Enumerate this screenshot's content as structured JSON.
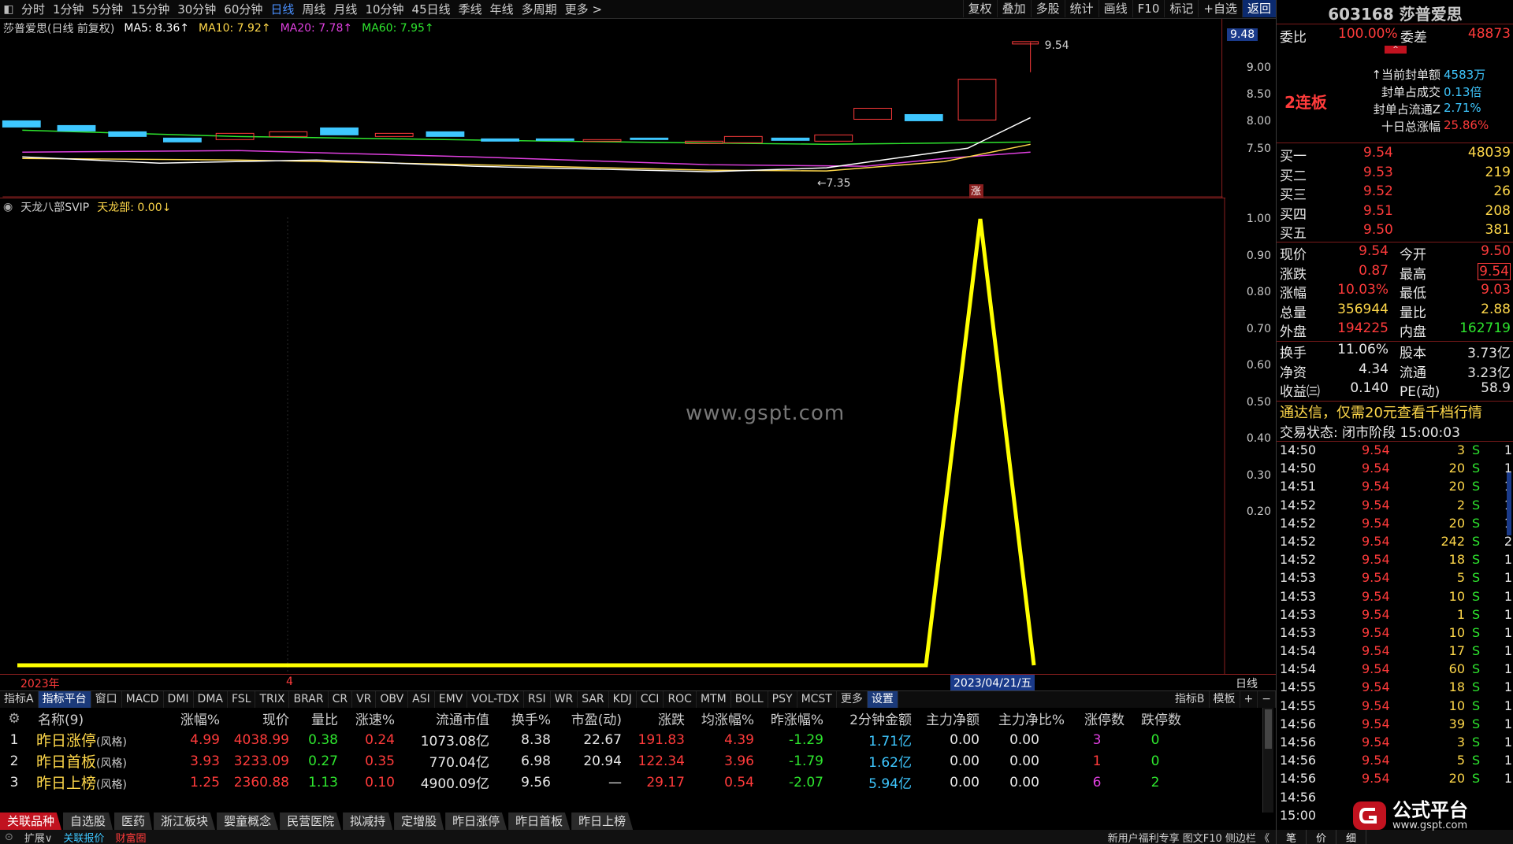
{
  "toolbar": {
    "periods": [
      "分时",
      "1分钟",
      "5分钟",
      "15分钟",
      "30分钟",
      "60分钟",
      "日线",
      "周线",
      "月线",
      "10分钟",
      "45日线",
      "季线",
      "年线",
      "多周期",
      "更多 >"
    ],
    "active_period": "日线",
    "right_buttons": [
      "复权",
      "叠加",
      "多股",
      "统计",
      "画线",
      "F10",
      "标记",
      "+自选",
      "返回"
    ]
  },
  "legend": {
    "title": "莎普爱思(日线 前复权)",
    "ma5": "MA5: 8.36↑",
    "ma10": "MA10: 7.92↑",
    "ma20": "MA20: 7.78↑",
    "ma60": "MA60: 7.95↑",
    "ma5_color": "#ffffff",
    "ma10_color": "#ffd84a",
    "ma20_color": "#e040e0",
    "ma60_color": "#2ee52e"
  },
  "price_axis": {
    "ticks": [
      "9.00",
      "8.50",
      "8.00",
      "7.50"
    ],
    "current": "9.48",
    "high_label": "9.54",
    "low_label": "←7.35",
    "limit_badge": "涨"
  },
  "indicator_legend": {
    "name": "天龙八部SVIP",
    "value": "天龙部: 0.00↓"
  },
  "indicator_axis": {
    "ticks": [
      "1.00",
      "0.90",
      "0.80",
      "0.70",
      "0.60",
      "0.50",
      "0.40",
      "0.30",
      "0.20"
    ]
  },
  "x_axis": {
    "year": "2023年",
    "month": "4",
    "cursor_date": "2023/04/21/五",
    "period_label": "日线"
  },
  "watermark": "www.gspt.com",
  "indicator_tabs": [
    "指标A",
    "指标平台",
    "窗口",
    "MACD",
    "DMI",
    "DMA",
    "FSL",
    "TRIX",
    "BRAR",
    "CR",
    "VR",
    "OBV",
    "ASI",
    "EMV",
    "VOL-TDX",
    "RSI",
    "WR",
    "SAR",
    "KDJ",
    "CCI",
    "ROC",
    "MTM",
    "BOLL",
    "PSY",
    "MCST",
    "更多",
    "设置"
  ],
  "indicator_tabs_right": [
    "指标B",
    "模板",
    "+",
    "−"
  ],
  "table": {
    "headers": [
      "名称(9)",
      "涨幅%",
      "现价",
      "量比",
      "涨速%",
      "流通市值",
      "换手%",
      "市盈(动)",
      "涨跌",
      "均涨幅%",
      "昨涨幅%",
      "2分钟金额",
      "主力净额",
      "主力净比%",
      "涨停数",
      "跌停数"
    ],
    "rows": [
      {
        "idx": "1",
        "name": "昨日涨停",
        "tag": "(风格)",
        "chg": "4.99",
        "price": "4038.99",
        "vr": "0.38",
        "spd": "0.24",
        "mcap": "1073.08亿",
        "turn": "8.38",
        "pe": "22.67",
        "diff": "191.83",
        "avg": "4.39",
        "prev": "-1.29",
        "amt": "1.71亿",
        "net": "0.00",
        "netp": "0.00",
        "up": "3",
        "dn": "0"
      },
      {
        "idx": "2",
        "name": "昨日首板",
        "tag": "(风格)",
        "chg": "3.93",
        "price": "3233.09",
        "vr": "0.27",
        "spd": "0.35",
        "mcap": "770.04亿",
        "turn": "6.98",
        "pe": "20.94",
        "diff": "122.34",
        "avg": "3.96",
        "prev": "-1.79",
        "amt": "1.62亿",
        "net": "0.00",
        "netp": "0.00",
        "up": "1",
        "dn": "0"
      },
      {
        "idx": "3",
        "name": "昨日上榜",
        "tag": "(风格)",
        "chg": "1.25",
        "price": "2360.88",
        "vr": "1.13",
        "spd": "0.10",
        "mcap": "4900.09亿",
        "turn": "9.56",
        "pe": "—",
        "diff": "29.17",
        "avg": "0.54",
        "prev": "-2.07",
        "amt": "5.94亿",
        "net": "0.00",
        "netp": "0.00",
        "up": "6",
        "dn": "2"
      }
    ]
  },
  "board_tabs": [
    "关联品种",
    "自选股",
    "医药",
    "浙江板块",
    "婴童概念",
    "民营医院",
    "拟减持",
    "定增股",
    "昨日涨停",
    "昨日首板",
    "昨日上榜"
  ],
  "statusbar": {
    "left": [
      "扩展∨",
      "关联报价",
      "财富圈"
    ],
    "right": "新用户福利专享 图文F10 侧边栏 《"
  },
  "quote": {
    "code_name": "603168 莎普爱思",
    "weibi_label": "委比",
    "weibi": "100.00%",
    "weicha_label": "委差",
    "weicha": "48873",
    "streak": "2连板",
    "seal_rows": [
      [
        "↑当前封单额",
        "4583万"
      ],
      [
        "封单占成交",
        "0.13倍"
      ],
      [
        "封单占流通Z",
        "2.71%"
      ],
      [
        "十日总涨幅",
        "25.86%"
      ]
    ],
    "bids": [
      [
        "买一",
        "9.54",
        "48039"
      ],
      [
        "买二",
        "9.53",
        "219"
      ],
      [
        "买三",
        "9.52",
        "26"
      ],
      [
        "买四",
        "9.51",
        "208"
      ],
      [
        "买五",
        "9.50",
        "381"
      ]
    ],
    "stats": [
      [
        "现价",
        "9.54",
        "今开",
        "9.50"
      ],
      [
        "涨跌",
        "0.87",
        "最高",
        "9.54"
      ],
      [
        "涨幅",
        "10.03%",
        "最低",
        "9.03"
      ],
      [
        "总量",
        "356944",
        "量比",
        "2.88"
      ],
      [
        "外盘",
        "194225",
        "内盘",
        "162719"
      ]
    ],
    "stats2": [
      [
        "换手",
        "11.06%",
        "股本",
        "3.73亿"
      ],
      [
        "净资",
        "4.34",
        "流通",
        "3.23亿"
      ],
      [
        "收益㈢",
        "0.140",
        "PE(动)",
        "58.9"
      ]
    ],
    "promo": "通达信，仅需20元查看千档行情",
    "trade_status": "交易状态: 闭市阶段 15:00:03",
    "ticks": [
      [
        "14:50",
        "9.54",
        "3",
        "S",
        "1"
      ],
      [
        "14:50",
        "9.54",
        "20",
        "S",
        "1"
      ],
      [
        "14:51",
        "9.54",
        "20",
        "S",
        "1"
      ],
      [
        "14:52",
        "9.54",
        "2",
        "S",
        "1"
      ],
      [
        "14:52",
        "9.54",
        "20",
        "S",
        "1"
      ],
      [
        "14:52",
        "9.54",
        "242",
        "S",
        "2"
      ],
      [
        "14:52",
        "9.54",
        "18",
        "S",
        "1"
      ],
      [
        "14:53",
        "9.54",
        "5",
        "S",
        "1"
      ],
      [
        "14:53",
        "9.54",
        "10",
        "S",
        "1"
      ],
      [
        "14:53",
        "9.54",
        "1",
        "S",
        "1"
      ],
      [
        "14:53",
        "9.54",
        "10",
        "S",
        "1"
      ],
      [
        "14:54",
        "9.54",
        "17",
        "S",
        "1"
      ],
      [
        "14:54",
        "9.54",
        "60",
        "S",
        "1"
      ],
      [
        "14:55",
        "9.54",
        "18",
        "S",
        "1"
      ],
      [
        "14:55",
        "9.54",
        "10",
        "S",
        "1"
      ],
      [
        "14:56",
        "9.54",
        "39",
        "S",
        "1"
      ],
      [
        "14:56",
        "9.54",
        "3",
        "S",
        "1"
      ],
      [
        "14:56",
        "9.54",
        "5",
        "S",
        "1"
      ],
      [
        "14:56",
        "9.54",
        "20",
        "S",
        "1"
      ],
      [
        "14:56",
        "",
        "",
        " ",
        ""
      ],
      [
        "15:00",
        "",
        "",
        " ",
        ""
      ]
    ],
    "bottom_tabs": [
      "笔",
      "价",
      "细"
    ]
  },
  "logo": {
    "text": "公式平台",
    "url": "www.gspt.com"
  },
  "chart_data": {
    "type": "line",
    "title": "天龙八部SVIP",
    "series": [
      {
        "name": "天龙部",
        "values": [
          0,
          0,
          0,
          0,
          0,
          0,
          0,
          0,
          0,
          0,
          0,
          0,
          0,
          0,
          0,
          0,
          0,
          0,
          1,
          0
        ]
      }
    ],
    "ylim": [
      0,
      1
    ]
  }
}
